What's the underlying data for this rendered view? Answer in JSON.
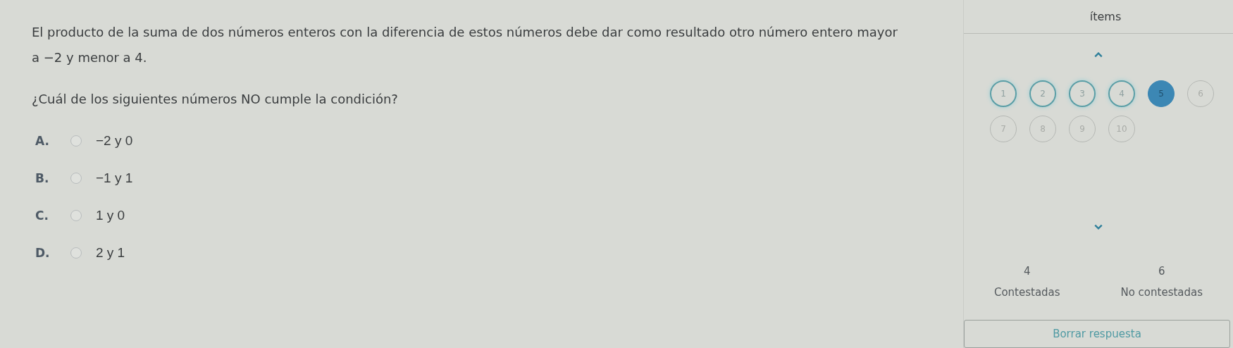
{
  "question": {
    "statement": "El producto de la suma de dos números enteros con la diferencia de estos números debe dar como resultado otro número entero mayor a −2 y menor a 4.",
    "prompt": "¿Cuál de los siguientes números NO cumple la condición?",
    "options": [
      {
        "letter": "A.",
        "text": "−2 y 0",
        "selected": false
      },
      {
        "letter": "B.",
        "text": "−1 y 1",
        "selected": false
      },
      {
        "letter": "C.",
        "text": "1 y 0",
        "selected": false
      },
      {
        "letter": "D.",
        "text": "2 y 1",
        "selected": false
      }
    ]
  },
  "items_panel": {
    "title": "ítems",
    "items": [
      {
        "label": "1",
        "answered": true,
        "selected": false
      },
      {
        "label": "2",
        "answered": true,
        "selected": false
      },
      {
        "label": "3",
        "answered": true,
        "selected": false
      },
      {
        "label": "4",
        "answered": true,
        "selected": false
      },
      {
        "label": "5",
        "answered": false,
        "selected": true
      },
      {
        "label": "6",
        "answered": false,
        "selected": false
      },
      {
        "label": "7",
        "answered": false,
        "selected": false
      },
      {
        "label": "8",
        "answered": false,
        "selected": false
      },
      {
        "label": "9",
        "answered": false,
        "selected": false
      },
      {
        "label": "10",
        "answered": false,
        "selected": false
      }
    ],
    "answered_count": "4",
    "answered_label": "Contestadas",
    "unanswered_count": "6",
    "unanswered_label": "No contestadas",
    "clear_button": "Borrar respuesta"
  }
}
